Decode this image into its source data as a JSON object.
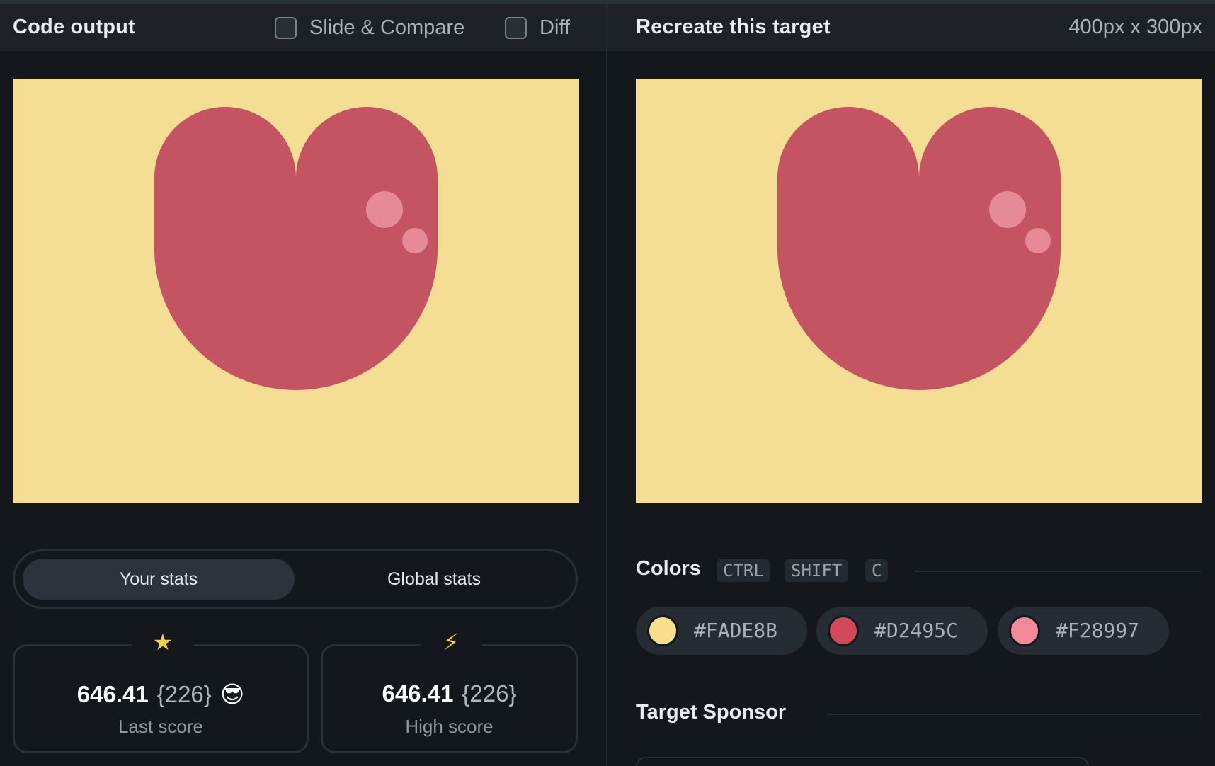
{
  "output_panel": {
    "title": "Code output",
    "slide_compare_label": "Slide & Compare",
    "diff_label": "Diff"
  },
  "target_panel": {
    "title": "Recreate this target",
    "dimensions": "400px x 300px"
  },
  "stats": {
    "tabs": [
      "Your stats",
      "Global stats"
    ],
    "last": {
      "icon": "star-icon",
      "glyph": "★",
      "value": "646.41",
      "count": "{226}",
      "emoji": "😎",
      "label": "Last score"
    },
    "high": {
      "icon": "lightning-icon",
      "glyph": "⚡",
      "value": "646.41",
      "count": "{226}",
      "label": "High score"
    }
  },
  "colors_section": {
    "title": "Colors",
    "shortcut": [
      "CTRL",
      "SHIFT",
      "C"
    ],
    "swatches": [
      {
        "hex": "#FADE8B",
        "color": "#FADE8B"
      },
      {
        "hex": "#D2495C",
        "color": "#D2495C"
      },
      {
        "hex": "#F28997",
        "color": "#F28997"
      }
    ]
  },
  "sponsor_section": {
    "title": "Target Sponsor"
  },
  "art": {
    "background": "#F4DE93",
    "heart": "#C45461",
    "highlight": "#E58A96"
  }
}
